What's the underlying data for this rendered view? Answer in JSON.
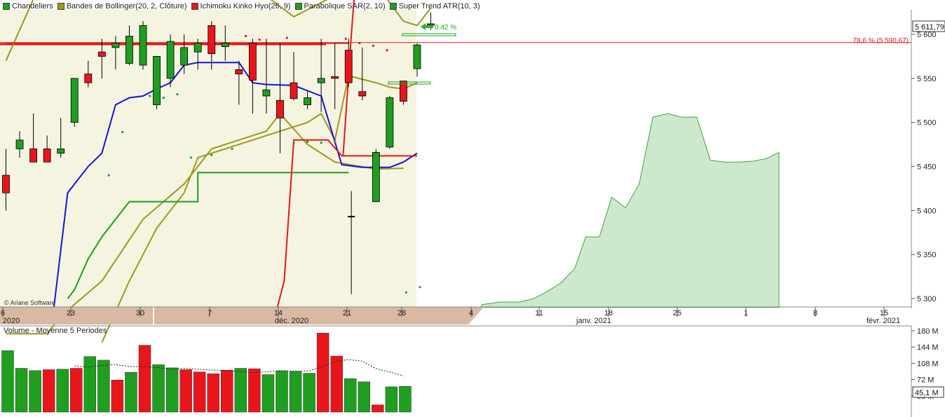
{
  "legend": [
    {
      "label": "Chandeliers",
      "color": "#1f9e1f"
    },
    {
      "label": "Bandes de Bollinger(20, 2, Clôture)",
      "color": "#9c9a1c"
    },
    {
      "label": "Ichimoku Kinko Hyo(26, 9)",
      "color": "#e31a1c"
    },
    {
      "label": "Parabolique SAR(2, 10)",
      "color": "#1f9e1f"
    },
    {
      "label": "Super Trend ATR(10, 3)",
      "color": "#1f9e1f"
    }
  ],
  "copyright": "© Ariane Software",
  "volume_title": "Volume  - Moyenne 5 Periodes",
  "annotations": {
    "last_price": "5 611,79",
    "pct_change": "0.42 %",
    "fib_level_label": "78,6 % (5 590,67)",
    "fib_level_value": 5590.67,
    "last_volume": "45,1 M"
  },
  "colors": {
    "up": "#1f9e1f",
    "down": "#e8161b",
    "bollinger": "#9c9a1c",
    "kijun": "#1515d6",
    "tenkan": "#e31a1c",
    "sar": "#1f9e1f",
    "supertrend": "#1f9e1f",
    "cloud": "#cde8cd",
    "band_fill": "#f4f4e0",
    "axis_band": "#d9b9a3",
    "fib_line": "#e31a1c"
  },
  "chart_data": {
    "type": "candlestick",
    "price_axis": {
      "ticks": [
        "5 600",
        "5 550",
        "5 500",
        "5 450",
        "5 400",
        "5 350",
        "5 300"
      ],
      "tick_values": [
        5600,
        5550,
        5500,
        5450,
        5400,
        5350,
        5300
      ]
    },
    "x_axis": {
      "day_labels": [
        "6",
        "23",
        "30",
        "7",
        "14",
        "21",
        "28",
        "4",
        "11",
        "18",
        "25",
        "1",
        "8",
        "15"
      ],
      "month_labels": [
        "2020",
        "déc. 2020",
        "janv. 2021",
        "févr. 2021"
      ]
    },
    "candles": [
      [
        5440,
        5470,
        5400,
        5420
      ],
      [
        5470,
        5490,
        5460,
        5480
      ],
      [
        5470,
        5510,
        5455,
        5455
      ],
      [
        5470,
        5485,
        5465,
        5455
      ],
      [
        5465,
        5505,
        5460,
        5470
      ],
      [
        5500,
        5550,
        5495,
        5550
      ],
      [
        5555,
        5570,
        5540,
        5545
      ],
      [
        5580,
        5595,
        5550,
        5575
      ],
      [
        5585,
        5598,
        5560,
        5590
      ],
      [
        5567,
        5610,
        5565,
        5598
      ],
      [
        5565,
        5615,
        5560,
        5610
      ],
      [
        5520,
        5570,
        5515,
        5575
      ],
      [
        5550,
        5600,
        5540,
        5592
      ],
      [
        5565,
        5600,
        5555,
        5585
      ],
      [
        5580,
        5595,
        5560,
        5590
      ],
      [
        5610,
        5615,
        5560,
        5578
      ],
      [
        5586,
        5610,
        5570,
        5590
      ],
      [
        5560,
        5570,
        5520,
        5555
      ],
      [
        5590,
        5595,
        5510,
        5548
      ],
      [
        5530,
        5595,
        5510,
        5537
      ],
      [
        5525,
        5590,
        5465,
        5505
      ],
      [
        5545,
        5580,
        5525,
        5527
      ],
      [
        5520,
        5535,
        5515,
        5528
      ],
      [
        5545,
        5595,
        5512,
        5550
      ],
      [
        5552,
        5590,
        5515,
        5550
      ],
      [
        5582,
        5595,
        5540,
        5545
      ],
      [
        5535,
        5585,
        5525,
        5530
      ],
      [
        5410,
        5470,
        5410,
        5466
      ],
      [
        5472,
        5530,
        5470,
        5528
      ],
      [
        5547,
        5540,
        5520,
        5524
      ],
      [
        5561,
        5590,
        5552,
        5588
      ],
      [
        5611,
        5625,
        5605,
        5612
      ]
    ],
    "doji": {
      "index": 25.2,
      "open": 5393,
      "high": 5422,
      "low": 5305,
      "close": 5393
    },
    "volume_series": [
      136,
      97,
      92,
      94,
      95,
      97,
      123,
      115,
      71,
      88,
      148,
      105,
      98,
      94,
      89,
      85,
      93,
      97,
      96,
      83,
      91,
      90,
      86,
      175,
      124,
      74,
      67,
      16,
      56,
      57
    ],
    "volume_colors": [
      "up",
      "up",
      "up",
      "down",
      "up",
      "down",
      "up",
      "up",
      "down",
      "up",
      "down",
      "up",
      "up",
      "down",
      "down",
      "down",
      "down",
      "up",
      "down",
      "up",
      "up",
      "up",
      "up",
      "down",
      "down",
      "up",
      "up",
      "down",
      "up",
      "up"
    ],
    "volume_avg": [
      null,
      null,
      null,
      null,
      null,
      102,
      100,
      103,
      105,
      101,
      101,
      99,
      95,
      97,
      95,
      93,
      92,
      90,
      88,
      89,
      92,
      91,
      91,
      100,
      112,
      116,
      113,
      96,
      89,
      80
    ],
    "volume_axis": {
      "ticks": [
        "180 M",
        "144 M",
        "108 M",
        "72 M",
        "36 M"
      ],
      "tick_values": [
        180,
        144,
        108,
        72,
        36
      ]
    },
    "cloud": [
      [
        34.7,
        5293
      ],
      [
        36,
        5296
      ],
      [
        37.5,
        5296
      ],
      [
        38.5,
        5300
      ],
      [
        39.5,
        5308
      ],
      [
        40.5,
        5318
      ],
      [
        41.5,
        5334
      ],
      [
        42.3,
        5370
      ],
      [
        43.3,
        5370
      ],
      [
        44.2,
        5415
      ],
      [
        45.2,
        5403
      ],
      [
        46.2,
        5430
      ],
      [
        47.2,
        5506
      ],
      [
        48.3,
        5510
      ],
      [
        49.3,
        5506
      ],
      [
        50.4,
        5506
      ],
      [
        51.4,
        5457
      ],
      [
        52.4,
        5455
      ],
      [
        53.5,
        5455
      ],
      [
        54.5,
        5456
      ],
      [
        55.5,
        5459
      ],
      [
        56.4,
        5466
      ]
    ],
    "bollinger_upper": [
      [
        0,
        5570
      ],
      [
        2,
        5640
      ],
      [
        3,
        5660
      ],
      [
        4,
        5720
      ],
      [
        14,
        5700
      ],
      [
        18,
        5655
      ],
      [
        21,
        5620
      ],
      [
        23.5,
        5640
      ],
      [
        24,
        5720
      ],
      [
        29,
        5615
      ],
      [
        30,
        5610
      ],
      [
        31,
        5630
      ]
    ],
    "bollinger_lower": [
      [
        0,
        5260
      ],
      [
        3,
        5260
      ],
      [
        4,
        5280
      ],
      [
        7,
        5320
      ],
      [
        10,
        5390
      ],
      [
        13,
        5430
      ],
      [
        14,
        5450
      ],
      [
        15,
        5470
      ],
      [
        19,
        5490
      ],
      [
        20,
        5510
      ],
      [
        22,
        5475
      ],
      [
        24,
        5455
      ],
      [
        27,
        5447
      ],
      [
        29,
        5448
      ]
    ],
    "bollinger_mid": [
      [
        7,
        5250
      ],
      [
        9,
        5320
      ],
      [
        11,
        5380
      ],
      [
        13,
        5420
      ],
      [
        14,
        5460
      ],
      [
        18,
        5480
      ],
      [
        20,
        5490
      ],
      [
        22,
        5500
      ],
      [
        23,
        5510
      ],
      [
        24,
        5480
      ],
      [
        25,
        5553
      ],
      [
        27,
        5545
      ],
      [
        28,
        5540
      ],
      [
        29,
        5538
      ],
      [
        30,
        5545
      ]
    ],
    "kijun": [
      [
        3.5,
        5290
      ],
      [
        4.5,
        5420
      ],
      [
        6,
        5450
      ],
      [
        7,
        5465
      ],
      [
        8,
        5520
      ],
      [
        9,
        5528
      ],
      [
        10,
        5530
      ],
      [
        11,
        5538
      ],
      [
        12,
        5545
      ],
      [
        13,
        5565
      ],
      [
        14,
        5568
      ],
      [
        17,
        5568
      ],
      [
        18,
        5545
      ],
      [
        19,
        5543
      ],
      [
        21,
        5542
      ],
      [
        23,
        5530
      ],
      [
        24.5,
        5452
      ],
      [
        26,
        5449
      ],
      [
        28,
        5449
      ],
      [
        29,
        5455
      ],
      [
        30,
        5465
      ]
    ],
    "tenkan": [
      [
        0,
        5590
      ],
      [
        24,
        5590
      ],
      [
        25,
        5590
      ],
      [
        25,
        5620
      ],
      [
        25.5,
        5620
      ],
      [
        26.5,
        5480
      ],
      [
        27,
        5460
      ],
      [
        30,
        5460
      ],
      [
        30,
        5460
      ],
      [
        20,
        5320
      ],
      [
        20.5,
        5320
      ],
      [
        21,
        5480
      ],
      [
        23.5,
        5480
      ],
      [
        24.5,
        5462
      ],
      [
        25,
        5462
      ]
    ],
    "supertrend": [
      [
        4.5,
        5300
      ],
      [
        5,
        5310
      ],
      [
        6,
        5345
      ],
      [
        7,
        5370
      ],
      [
        8,
        5390
      ],
      [
        9,
        5410
      ],
      [
        10,
        5410
      ],
      [
        14,
        5410
      ],
      [
        14,
        5443
      ],
      [
        15,
        5443
      ],
      [
        25,
        5443
      ]
    ],
    "sar": [
      [
        7.5,
        5440
      ],
      [
        8.5,
        5489
      ],
      [
        10.5,
        5530
      ],
      [
        11.5,
        5528
      ],
      [
        12.5,
        5532
      ],
      [
        13.5,
        5460
      ],
      [
        15,
        5463
      ],
      [
        16.5,
        5470
      ],
      [
        17.5,
        5598
      ],
      [
        18.5,
        5594
      ],
      [
        20.5,
        5596
      ],
      [
        21,
        5476
      ],
      [
        22,
        5478
      ],
      [
        23,
        5477
      ],
      [
        24,
        5478
      ],
      [
        24.8,
        5595
      ],
      [
        25.8,
        5590
      ],
      [
        26.8,
        5587
      ],
      [
        27.8,
        5582
      ],
      [
        29.2,
        5307
      ],
      [
        30.2,
        5313
      ]
    ]
  }
}
